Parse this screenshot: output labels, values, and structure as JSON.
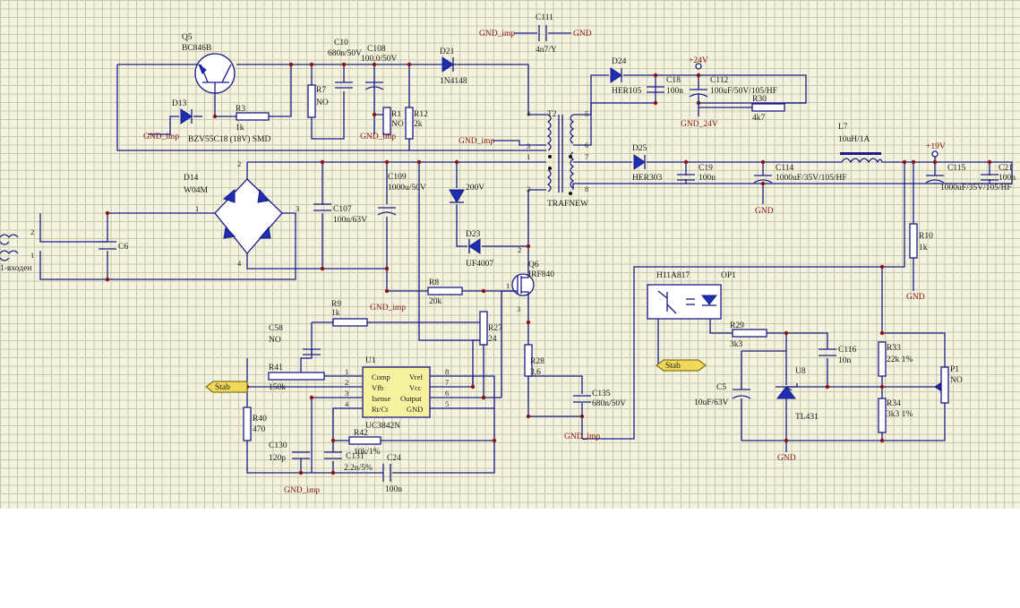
{
  "labels": {
    "Q5": "Q5",
    "BC846B": "BC846B",
    "D13": "D13",
    "R3": "R3",
    "R3v": "1k",
    "BZV": "BZV55C18 (18V) SMD",
    "GND_imp1": "GND_imp",
    "C10": "C10",
    "C10v": "680n/50V",
    "C108": "C108",
    "C108v": "100.0/50V",
    "R7": "R7",
    "R7v": "NO",
    "R1": "R1",
    "R1v": "NO",
    "R12": "R12",
    "R12v": "2k",
    "GND_imp2": "GND_imp",
    "D21": "D21",
    "D21v": "1N4148",
    "GND_impC111": "GND_imp",
    "C111": "C111",
    "C111v": "4n7/Y",
    "GNDtop": "GND",
    "D24": "D24",
    "D24v": "HER105",
    "C18": "C18",
    "C18v": "100n",
    "p24V": "+24V",
    "C112": "C112",
    "C112v": "100uF/50V/105/HF",
    "GND_24V": "GND_24V",
    "R30": "R30",
    "R30v": "4k7",
    "L7": "L7",
    "L7v": "10uH/1A",
    "p19V": "+19V",
    "T2": "T2",
    "TRAFNEW": "TRAFNEW",
    "GND_imp3": "GND_imp",
    "D25": "D25",
    "D25v": "HER303",
    "C19": "C19",
    "C19v": "100n",
    "C114": "C114",
    "C114v": "1000uF/35V/105/HF",
    "GND1": "GND",
    "C115": "C115",
    "C115v": "1000uF/35V/105/HF",
    "C21": "C21",
    "C21v": "100n",
    "D14": "D14",
    "D14v": "W04M",
    "C109": "C109",
    "C109v": "1000u/50V",
    "C107": "C107",
    "C107v": "100n/63V",
    "D200": "200V",
    "D23": "D23",
    "D23v": "UF4007",
    "Q6": "Q6",
    "Q6v": "IRF840",
    "C6": "C6",
    "inputLbl": "1-входен",
    "R8": "R8",
    "R8v": "20k",
    "GND_imp4": "GND_imp",
    "H11": "H11A817",
    "OP1": "OP1",
    "R10": "R10",
    "R10v": "1k",
    "GND2": "GND",
    "R9": "R9",
    "R9v": "1k",
    "C58": "C58",
    "C58v": "NO",
    "R27": "R27",
    "R27v": "24",
    "R41": "R41",
    "R41v": "150k",
    "U1": "U1",
    "UC": "UC3842N",
    "pinComp": "Comp",
    "pinVfb": "Vfb",
    "pinIsense": "Isense",
    "pinRtCt": "Rt/Ct",
    "pinVref": "Vref",
    "pinVcc": "Vcc",
    "pinOutput": "Output",
    "pinGND": "GND",
    "R28": "R28",
    "R28v": "3,6",
    "C135": "C135",
    "C135v": "680n/50V",
    "GND_imp5": "GND_imp",
    "R29": "R29",
    "R29v": "3k3",
    "C116": "C116",
    "C116v": "10n",
    "R33": "R33",
    "R33v": "22k 1%",
    "P1": "P1",
    "P1v": "NO",
    "C5": "C5",
    "C5v": "10uF/63V",
    "U8": "U8",
    "TL431": "TL431",
    "R34": "R34",
    "R34v": "3k3 1%",
    "GND3": "GND",
    "R40": "R40",
    "R40v": "470",
    "C130": "C130",
    "C130v": "120p",
    "R42": "R42",
    "R42v": "10k/1%",
    "C131": "C131",
    "C131v": "2.2n/5%",
    "C24": "C24",
    "C24v": "100n",
    "GND_imp6": "GND_imp",
    "stabL": "Stab",
    "stabR": "Stab"
  },
  "colors": {
    "wire": "#1b1b8a",
    "label": "#1a1a1a",
    "netlabel": "#8a1212",
    "fill": "#1b2fb0",
    "grid": "#c8c8a8"
  }
}
